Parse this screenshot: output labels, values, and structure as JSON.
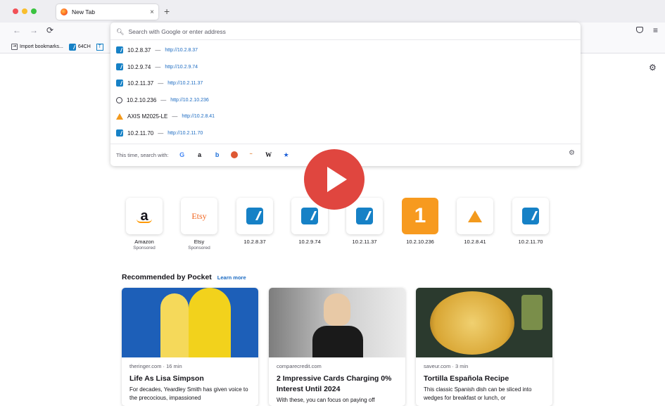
{
  "browser": {
    "tab": {
      "title": "New Tab",
      "close": "×"
    },
    "new_tab_button": "+",
    "nav": {
      "back": "←",
      "forward": "→",
      "reload": "⟳"
    },
    "menu": "≡"
  },
  "bookmarks": [
    {
      "label": "Import bookmarks...",
      "icon": "import-icon"
    },
    {
      "label": "64CH",
      "icon": "axis-icon"
    },
    {
      "label": "T",
      "icon": "t-icon"
    }
  ],
  "urlbar": {
    "placeholder": "Search with Google or enter address",
    "results": [
      {
        "title": "10.2.8.37",
        "url": "http://10.2.8.37",
        "icon": "axis"
      },
      {
        "title": "10.2.9.74",
        "url": "http://10.2.9.74",
        "icon": "axis"
      },
      {
        "title": "10.2.11.37",
        "url": "http://10.2.11.37",
        "icon": "axis"
      },
      {
        "title": "10.2.10.236",
        "url": "http://10.2.10.236",
        "icon": "globe"
      },
      {
        "title": "AXIS M2025-LE",
        "url": "http://10.2.8.41",
        "icon": "triangle"
      },
      {
        "title": "10.2.11.70",
        "url": "http://10.2.11.70",
        "icon": "axis"
      }
    ],
    "separator": "—",
    "oneoff_label": "This time, search with:",
    "engines": [
      "G",
      "a",
      "b",
      "",
      "~",
      "W",
      "★"
    ]
  },
  "top_sites": [
    {
      "label": "Amazon",
      "sponsored": "Sponsored",
      "logo": "a"
    },
    {
      "label": "Etsy",
      "sponsored": "Sponsored",
      "logo": "Etsy"
    },
    {
      "label": "10.2.8.37",
      "logo": "axis"
    },
    {
      "label": "10.2.9.74",
      "logo": "axis"
    },
    {
      "label": "10.2.11.37",
      "logo": "axis"
    },
    {
      "label": "10.2.10.236",
      "logo": "1"
    },
    {
      "label": "10.2.8.41",
      "logo": "triangle"
    },
    {
      "label": "10.2.11.70",
      "logo": "axis"
    }
  ],
  "pocket": {
    "heading": "Recommended by Pocket",
    "learn_more": "Learn more",
    "stories": [
      {
        "source": "theringer.com · 16 min",
        "title": "Life As Lisa Simpson",
        "excerpt": "For decades, Yeardley Smith has given voice to the precocious, impassioned"
      },
      {
        "source": "comparecredit.com",
        "title": "2 Impressive Cards Charging 0% Interest Until 2024",
        "excerpt": "With these, you can focus on paying off"
      },
      {
        "source": "saveur.com · 3 min",
        "title": "Tortilla Española Recipe",
        "excerpt": "This classic Spanish dish can be sliced into wedges for breakfast or lunch, or"
      }
    ]
  },
  "colors": {
    "accent_link": "#1c6bc2",
    "axis_blue": "#1681c6",
    "play_red": "#e0463f"
  }
}
